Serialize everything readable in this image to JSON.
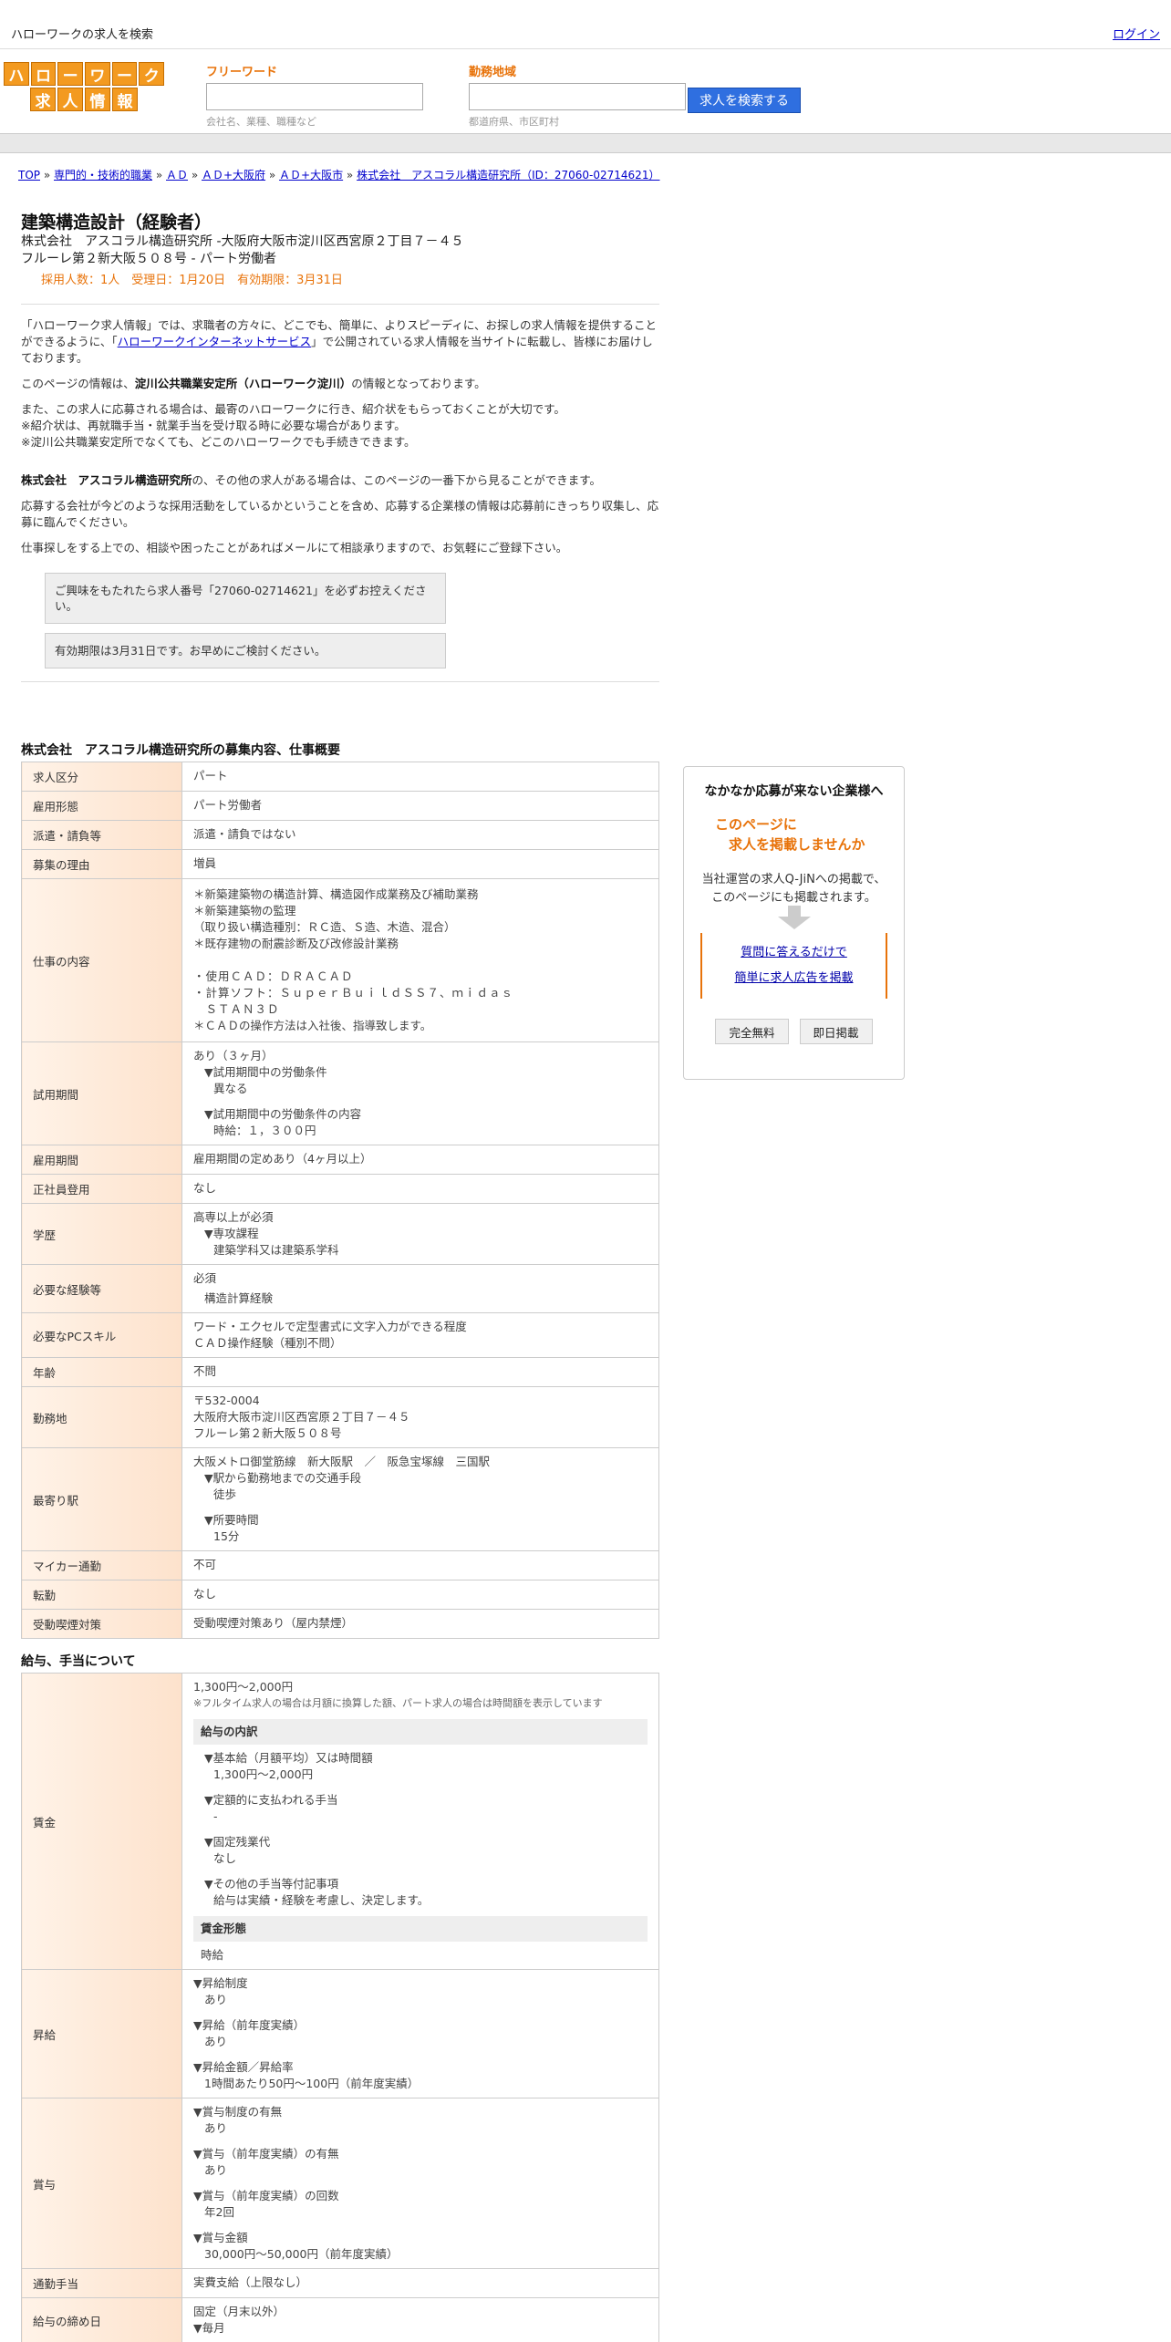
{
  "topbar": {
    "title": "ハローワークの求人を検索",
    "login": "ログイン"
  },
  "logo": {
    "row1": [
      "ハ",
      "ロ",
      "ー",
      "ワ",
      "ー",
      "ク"
    ],
    "row2": [
      "求",
      "人",
      "情",
      "報"
    ]
  },
  "search": {
    "freeword_label": "フリーワード",
    "freeword_value": "",
    "freeword_hint": "会社名、業種、職種など",
    "area_label": "勤務地域",
    "area_value": "",
    "area_hint": "都道府県、市区町村",
    "button": "求人を検索する"
  },
  "breadcrumb": [
    "TOP",
    "専門的・技術的職業",
    "ＡＤ",
    "ＡＤ+大阪府",
    "ＡＤ+大阪市",
    "株式会社　アスコラル構造研究所（ID：27060-02714621）"
  ],
  "job": {
    "title": "建築構造設計（経験者）",
    "company_line1": "株式会社　アスコラル構造研究所 -大阪府大阪市淀川区西宮原２丁目７－４５",
    "company_line2": "フルーレ第２新大阪５０８号 - パート労働者",
    "recruit_info": "採用人数：1人　受理日：1月20日　有効期限：3月31日"
  },
  "intro": {
    "p1_a": "「ハローワーク求人情報」では、求職者の方々に、どこでも、簡単に、よりスピーディに、お探しの求人情報を提供することができるように、「",
    "p1_link": "ハローワークインターネットサービス",
    "p1_b": "」で公開されている求人情報を当サイトに転載し、皆様にお届けしております。",
    "p2_a": "このページの情報は、",
    "p2_b": "淀川公共職業安定所（ハローワーク淀川）",
    "p2_c": "の情報となっております。",
    "p3_1": "また、この求人に応募される場合は、最寄のハローワークに行き、紹介状をもらっておくことが大切です。",
    "p3_2": "※紹介状は、再就職手当・就業手当を受け取る時に必要な場合があります。",
    "p3_3": "※淀川公共職業安定所でなくても、どこのハローワークでも手続きできます。",
    "p4_a": "株式会社　アスコラル構造研究所",
    "p4_b": "の、その他の求人がある場合は、このページの一番下から見ることができます。",
    "p5": "応募する会社が今どのような採用活動をしているかということを含め、応募する企業様の情報は応募前にきっちり収集し、応募に臨んでください。",
    "p6": "仕事探しをする上での、相談や困ったことがあればメールにて相談承りますので、お気軽にご登録下さい。",
    "notice1": "ご興味をもたれたら求人番号「27060-02714621」を必ずお控えください。",
    "notice2": "有効期限は3月31日です。お早めにご検討ください。"
  },
  "overview": {
    "title": "株式会社　アスコラル構造研究所の募集内容、仕事概要",
    "rows": {
      "kubun": {
        "label": "求人区分",
        "value": "パート"
      },
      "keitai": {
        "label": "雇用形態",
        "value": "パート労働者"
      },
      "haken": {
        "label": "派遣・請負等",
        "value": "派遣・請負ではない"
      },
      "riyu": {
        "label": "募集の理由",
        "value": "増員"
      },
      "naiyo": {
        "label": "仕事の内容",
        "lines": [
          "＊新築建築物の構造計算、構造図作成業務及び補助業務",
          "＊新築建築物の監理",
          "（取り扱い構造種別：ＲＣ造、Ｓ造、木造、混合）",
          "＊既存建物の耐震診断及び改修設計業務",
          "",
          "・使用ＣＡＤ：ＤＲＡＣＡＤ",
          "・計算ソフト：ＳｕｐｅｒＢｕｉｌｄＳＳ７、ｍｉｄａｓ",
          "　ＳＴＡＮ３Ｄ",
          "＊ＣＡＤの操作方法は入社後、指導致します。"
        ]
      },
      "shiyo": {
        "label": "試用期間",
        "v1": "あり（３ヶ月）",
        "v2": "▼試用期間中の労働条件",
        "v3": "異なる",
        "v4": "▼試用期間中の労働条件の内容",
        "v5": "時給：１，３００円"
      },
      "koyo_kikan": {
        "label": "雇用期間",
        "value": "雇用期間の定めあり（4ヶ月以上）"
      },
      "seishain": {
        "label": "正社員登用",
        "value": "なし"
      },
      "gakureki": {
        "label": "学歴",
        "v1": "高専以上が必須",
        "v2": "▼専攻課程",
        "v3": "建築学科又は建築系学科"
      },
      "keiken": {
        "label": "必要な経験等",
        "v1": "必須",
        "v2": "構造計算経験"
      },
      "pc": {
        "label": "必要なPCスキル",
        "v1": "ワード・エクセルで定型書式に文字入力ができる程度",
        "v2": "ＣＡＤ操作経験（種別不問）"
      },
      "nenrei": {
        "label": "年齢",
        "value": "不問"
      },
      "kinmuchi": {
        "label": "勤務地",
        "v1": "〒532-0004",
        "v2": "大阪府大阪市淀川区西宮原２丁目７－４５",
        "v3": "フルーレ第２新大阪５０８号"
      },
      "eki": {
        "label": "最寄り駅",
        "v1": "大阪メトロ御堂筋線　新大阪駅　／　阪急宝塚線　三国駅",
        "v2": "▼駅から勤務地までの交通手段",
        "v3": "徒歩",
        "v4": "▼所要時間",
        "v5": "15分"
      },
      "mycar": {
        "label": "マイカー通勤",
        "value": "不可"
      },
      "tenkin": {
        "label": "転勤",
        "value": "なし"
      },
      "kitsuen": {
        "label": "受動喫煙対策",
        "value": "受動喫煙対策あり（屋内禁煙）"
      }
    }
  },
  "salary": {
    "title": "給与、手当について",
    "chingin": {
      "label": "賃金",
      "range": "1,300円〜2,000円",
      "note": "※フルタイム求人の場合は月額に換算した額、パート求人の場合は時間額を表示しています",
      "breakdown_title": "給与の内訳",
      "b1": "▼基本給（月額平均）又は時間額",
      "b1v": "1,300円〜2,000円",
      "b2": "▼定額的に支払われる手当",
      "b2v": "-",
      "b3": "▼固定残業代",
      "b3v": "なし",
      "b4": "▼その他の手当等付記事項",
      "b4v": "給与は実績・経験を考慮し、決定します。",
      "form_title": "賃金形態",
      "form_value": "時給"
    },
    "shokyu": {
      "label": "昇給",
      "a": "▼昇給制度",
      "av": "あり",
      "b": "▼昇給（前年度実績）",
      "bv": "あり",
      "c": "▼昇給金額／昇給率",
      "cv": "1時間あたり50円〜100円（前年度実績）"
    },
    "shoyo": {
      "label": "賞与",
      "a": "▼賞与制度の有無",
      "av": "あり",
      "b": "▼賞与（前年度実績）の有無",
      "bv": "あり",
      "c": "▼賞与（前年度実績）の回数",
      "cv": "年2回",
      "d": "▼賞与金額",
      "dv": "30,000円〜50,000円（前年度実績）"
    },
    "tsukin": {
      "label": "通勤手当",
      "value": "実費支給（上限なし）"
    },
    "shimebi": {
      "label": "給与の締め日",
      "v1": "固定（月末以外）",
      "v2": "▼毎月"
    }
  },
  "side": {
    "title": "なかなか応募が来ない企業様へ",
    "orange1": "このページに",
    "orange2": "　求人を掲載しませんか",
    "desc1": "当社運営の求人Q-JiNへの掲載で、",
    "desc2": "このページにも掲載されます。",
    "link1": "質問に答えるだけで",
    "link2": "簡単に求人広告を掲載",
    "btn1": "完全無料",
    "btn2": "即日掲載"
  }
}
